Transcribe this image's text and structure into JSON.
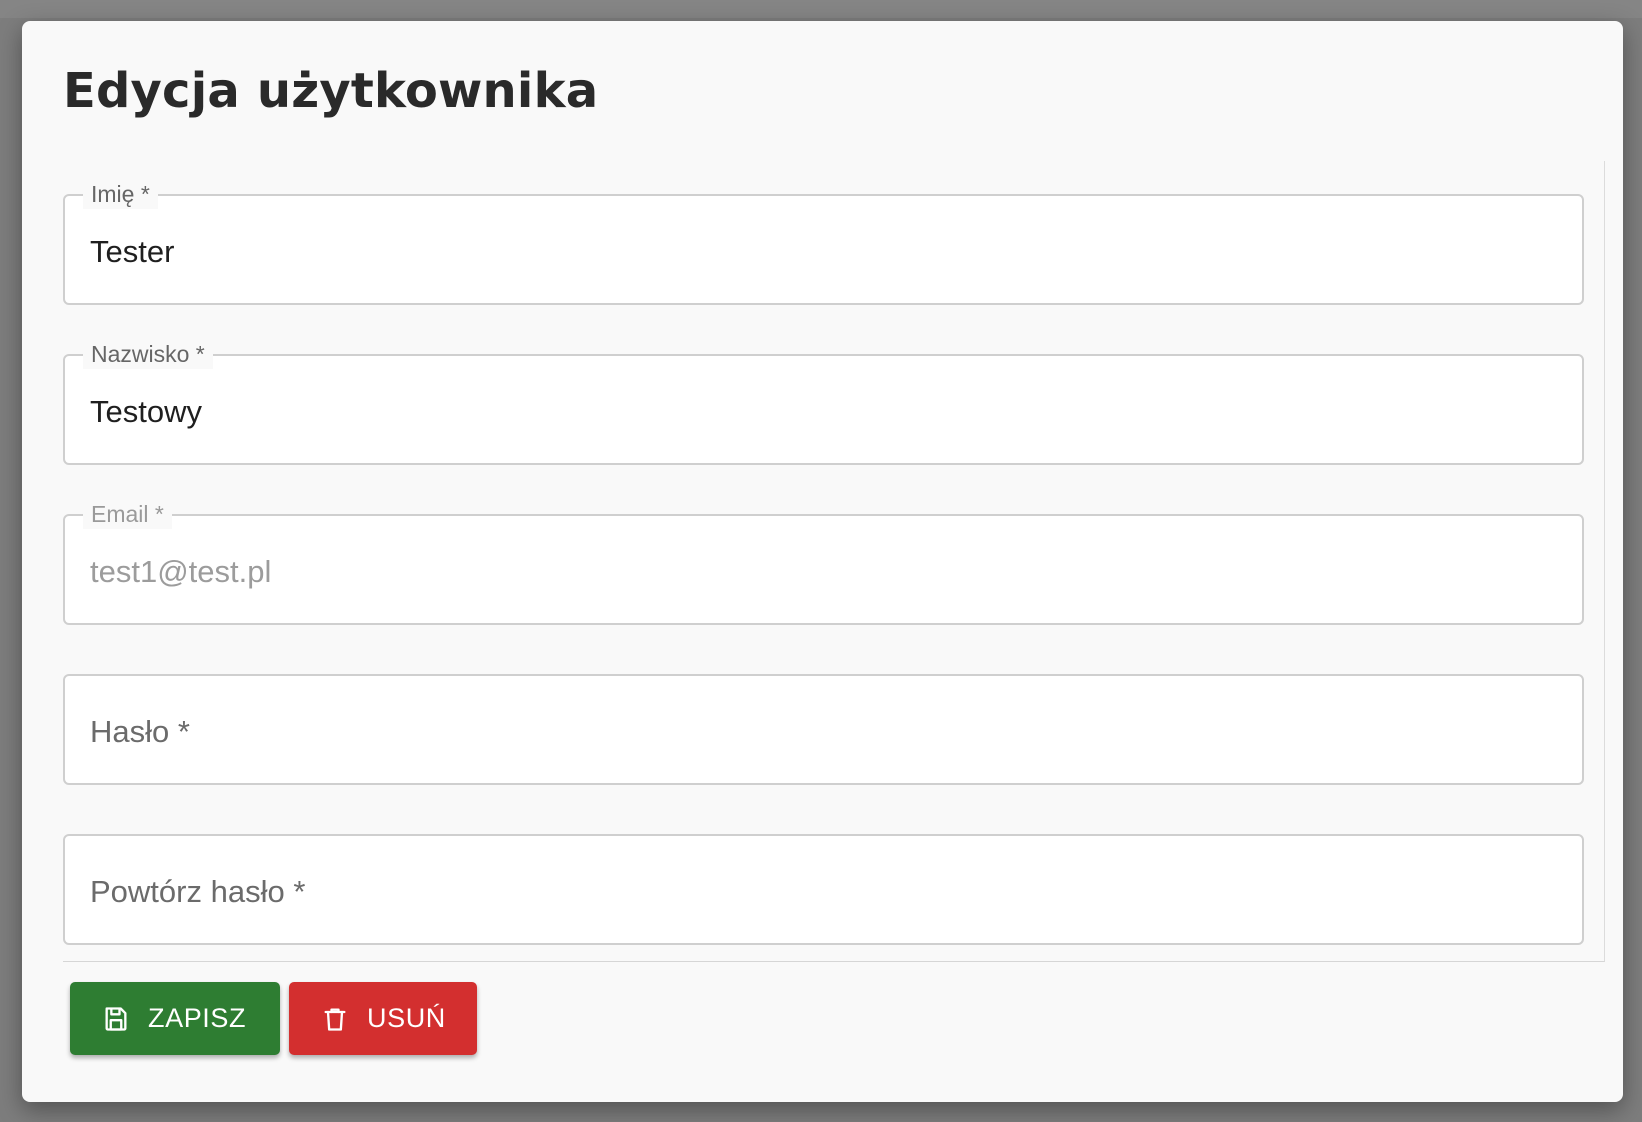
{
  "dialog": {
    "title": "Edycja użytkownika"
  },
  "fields": [
    {
      "label": "Imię *",
      "value": "Tester",
      "disabled": false
    },
    {
      "label": "Nazwisko *",
      "value": "Testowy",
      "disabled": false
    },
    {
      "label": "Email *",
      "value": "test1@test.pl",
      "disabled": true
    },
    {
      "placeholder": "Hasło *",
      "value": ""
    },
    {
      "placeholder": "Powtórz hasło *",
      "value": ""
    }
  ],
  "actions": {
    "save_label": "ZAPISZ",
    "save_icon": "save-icon",
    "delete_label": "USUŃ",
    "delete_icon": "trash-icon"
  },
  "colors": {
    "save": "#2e7d32",
    "delete": "#d32f2f"
  }
}
